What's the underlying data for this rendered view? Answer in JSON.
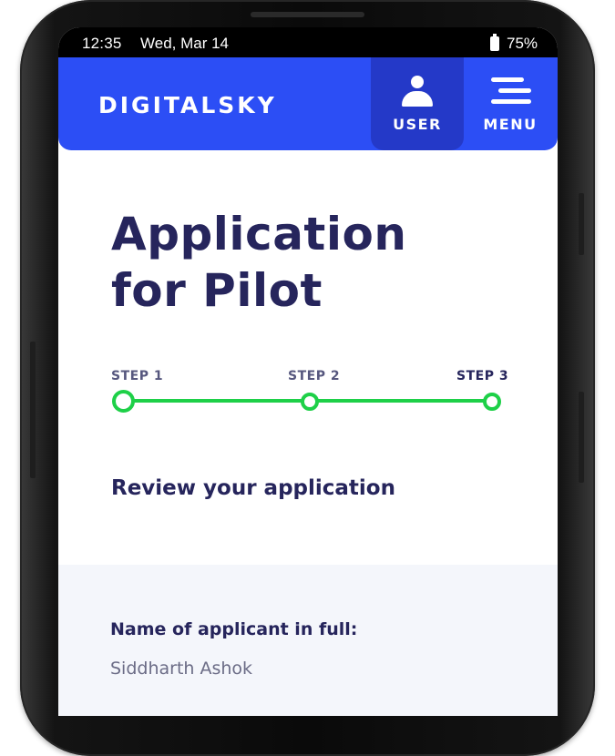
{
  "status_bar": {
    "time": "12:35",
    "date": "Wed, Mar 14",
    "battery": "75%",
    "battery_icon": "battery-icon"
  },
  "header": {
    "logo": "DIGITALSKY",
    "user_label": "USER",
    "menu_label": "MENU",
    "user_icon": "user-icon",
    "menu_icon": "menu-icon",
    "brand_color": "#2c4ef5",
    "active_color": "#2439c8"
  },
  "main": {
    "title_line1": "Application",
    "title_line2": "for Pilot",
    "steps": [
      {
        "label": "STEP 1"
      },
      {
        "label": "STEP 2"
      },
      {
        "label": "STEP 3"
      }
    ],
    "progress_color": "#1ed048",
    "section_title": "Review your application"
  },
  "review": {
    "fields": [
      {
        "label": "Name of applicant in full:",
        "value": "Siddharth Ashok"
      }
    ]
  }
}
